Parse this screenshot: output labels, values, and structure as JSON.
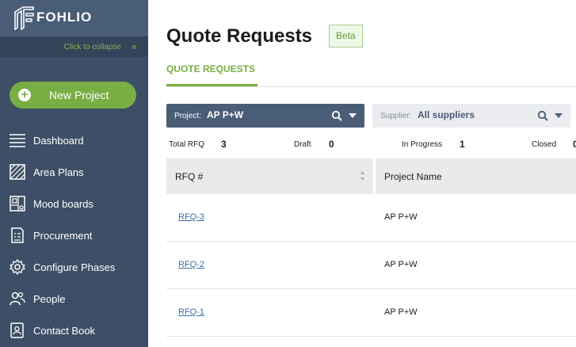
{
  "brand": {
    "name": "FOHLIO"
  },
  "sidebar": {
    "collapse_label": "Click to collapse",
    "new_project_label": "New Project",
    "items": [
      {
        "label": "Dashboard",
        "icon": "list-icon"
      },
      {
        "label": "Area Plans",
        "icon": "area-plan-icon"
      },
      {
        "label": "Mood boards",
        "icon": "mood-board-icon"
      },
      {
        "label": "Procurement",
        "icon": "procurement-icon"
      },
      {
        "label": "Configure Phases",
        "icon": "gear-icon"
      },
      {
        "label": "People",
        "icon": "people-icon"
      },
      {
        "label": "Contact Book",
        "icon": "contact-book-icon"
      }
    ]
  },
  "header": {
    "title": "Quote Requests",
    "badge": "Beta"
  },
  "tabs": [
    {
      "label": "QUOTE REQUESTS",
      "active": true
    }
  ],
  "filters": {
    "project": {
      "prefix": "Project:",
      "value": "AP P+W"
    },
    "supplier": {
      "prefix": "Supplier:",
      "value": "All suppliers"
    }
  },
  "stats": [
    {
      "label": "Total RFQ",
      "value": "3"
    },
    {
      "label": "Draft",
      "value": "0"
    },
    {
      "label": "In Progress",
      "value": "1"
    },
    {
      "label": "Closed",
      "value": "0"
    }
  ],
  "table": {
    "columns": [
      "RFQ #",
      "Project Name"
    ],
    "rows": [
      {
        "rfq": "RFQ-3",
        "project": "AP P+W"
      },
      {
        "rfq": "RFQ-2",
        "project": "AP P+W"
      },
      {
        "rfq": "RFQ-1",
        "project": "AP P+W"
      }
    ]
  },
  "colors": {
    "accent": "#78ae43",
    "sidebar": "#3d4f66",
    "link": "#3a6ea5"
  }
}
